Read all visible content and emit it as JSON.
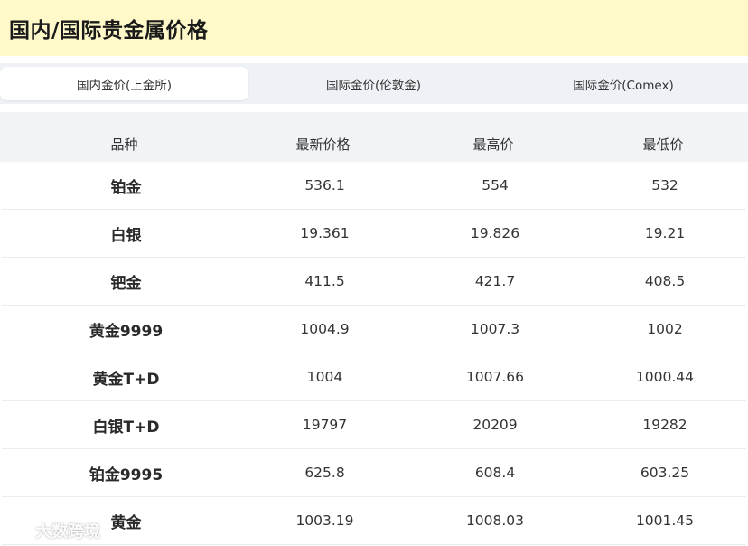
{
  "header": {
    "title": "国内/国际贵金属价格"
  },
  "tabs": [
    {
      "label": "国内金价(上金所)",
      "active": true
    },
    {
      "label": "国际金价(伦敦金)",
      "active": false
    },
    {
      "label": "国际金价(Comex)",
      "active": false
    }
  ],
  "table": {
    "columns": [
      "品种",
      "最新价格",
      "最高价",
      "最低价"
    ],
    "rows": [
      [
        "铂金",
        "536.1",
        "554",
        "532"
      ],
      [
        "白银",
        "19.361",
        "19.826",
        "19.21"
      ],
      [
        "钯金",
        "411.5",
        "421.7",
        "408.5"
      ],
      [
        "黄金9999",
        "1004.9",
        "1007.3",
        "1002"
      ],
      [
        "黄金T+D",
        "1004",
        "1007.66",
        "1000.44"
      ],
      [
        "白银T+D",
        "19797",
        "20209",
        "19282"
      ],
      [
        "铂金9995",
        "625.8",
        "608.4",
        "603.25"
      ],
      [
        "黄金",
        "1003.19",
        "1008.03",
        "1001.45"
      ]
    ]
  },
  "watermark": {
    "text": "大数跨境"
  },
  "colors": {
    "header_bg": "#fff9c9",
    "tabs_bg": "#eef1f6",
    "thead_bg": "#f1f3f6"
  }
}
